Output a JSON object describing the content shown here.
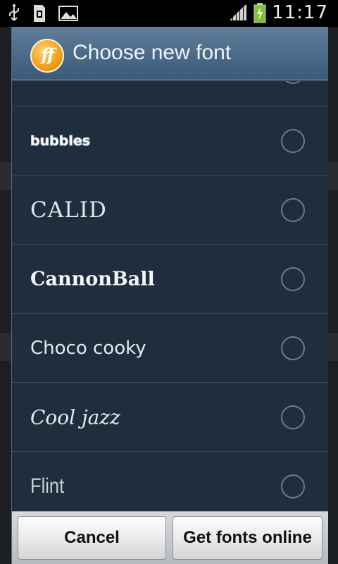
{
  "status_bar": {
    "time": "11:17",
    "icons": [
      "usb-icon",
      "sd-card-icon",
      "gallery-icon",
      "signal-icon",
      "battery-charging-icon"
    ]
  },
  "dialog": {
    "title": "Choose new font",
    "logo_text": "ff",
    "fonts": [
      {
        "label": "bubbles",
        "selected": false
      },
      {
        "label": "CALID",
        "selected": false
      },
      {
        "label": "CannonBall",
        "selected": false
      },
      {
        "label": "Choco cooky",
        "selected": false
      },
      {
        "label": "Cool jazz",
        "selected": false
      },
      {
        "label": "Flint",
        "selected": false
      }
    ],
    "buttons": {
      "cancel": "Cancel",
      "get_online": "Get fonts online"
    }
  },
  "colors": {
    "header": "#4b6a88",
    "list_bg": "#1f2d3c",
    "logo": "#f4a21b"
  }
}
